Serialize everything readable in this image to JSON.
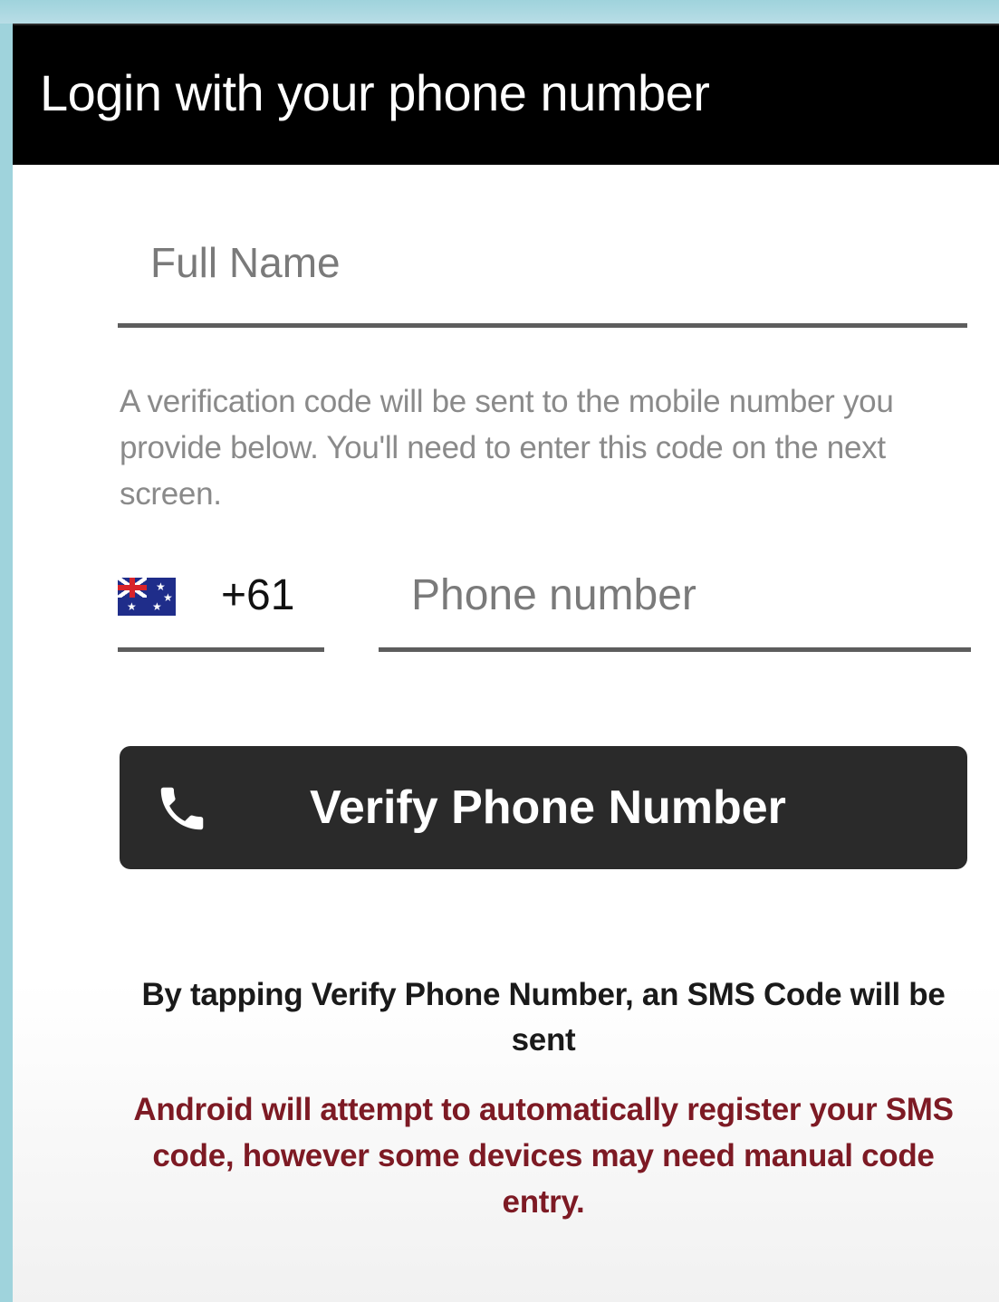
{
  "app_bar": {
    "title": "Login with your phone number"
  },
  "form": {
    "full_name": {
      "placeholder": "Full Name",
      "value": ""
    },
    "helper_text": "A verification code will be sent to the mobile number you provide below. You'll need to enter this code on the next screen.",
    "country": {
      "flag_icon": "australia-flag-icon",
      "dial_code": "+61"
    },
    "phone_number": {
      "placeholder": "Phone number",
      "value": ""
    },
    "verify_button": {
      "icon": "phone-icon",
      "label": "Verify Phone Number"
    },
    "disclaimer": "By tapping Verify Phone Number, an SMS Code will be sent",
    "android_note": "Android will attempt to automatically register your SMS code, however some devices may need manual code entry."
  },
  "colors": {
    "app_bar_background": "#000000",
    "button_background": "#2a2a2a",
    "android_note_text": "#7d1a24",
    "frame_background": "#9fd3dc"
  }
}
